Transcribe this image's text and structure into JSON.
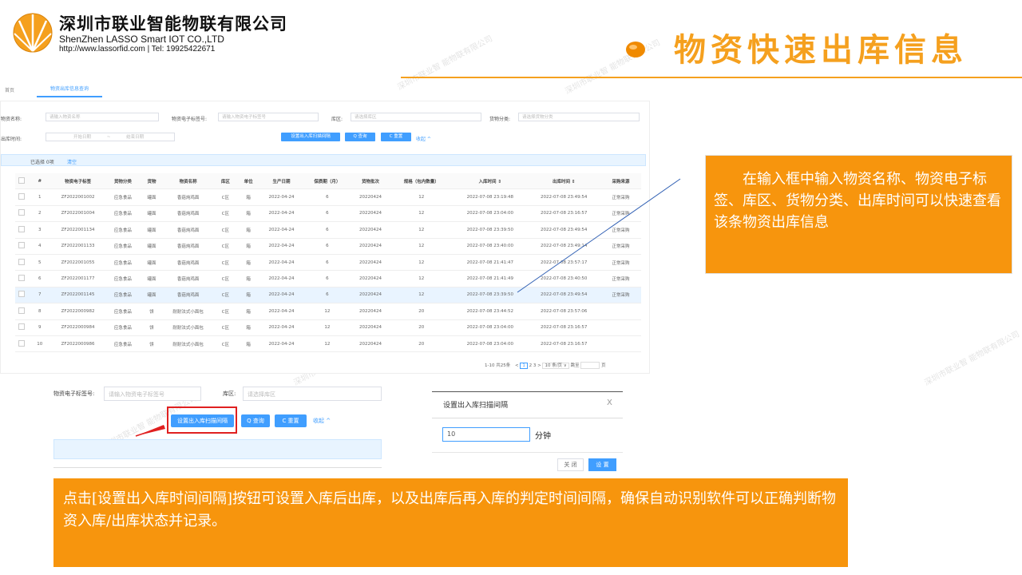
{
  "header": {
    "company_cn": "深圳市联业智能物联有限公司",
    "company_en": "ShenZhen LASSO Smart IOT CO.,LTD",
    "company_contact": "http://www.lassorfid.com | Tel: 19925422671",
    "page_title": "物资快速出库信息"
  },
  "colors": {
    "accent": "#f5a01e",
    "callout": "#f7950d",
    "primary": "#409eff"
  },
  "app": {
    "breadcrumb_home": "首页",
    "active_tab": "物资出库信息查询",
    "filters": {
      "material_name_label": "物资名称:",
      "material_name_placeholder": "请输入物资名称",
      "tag_label": "物资电子标签号:",
      "tag_placeholder": "请输入物资电子标签号",
      "area_label": "库区:",
      "area_placeholder": "请选择库区",
      "category_label": "货物分类:",
      "category_placeholder": "请选择货物分类",
      "out_time_label": "出库时间:",
      "start_placeholder": "开始日期",
      "range_sep": "~",
      "end_placeholder": "结束日期"
    },
    "buttons": {
      "set_interval": "设置出入库扫描间隔",
      "search": "Q 查询",
      "reset": "C 重置",
      "collapse": "收起 ^"
    },
    "selection": {
      "selected": "已选择 0项",
      "clear": "清空"
    },
    "table": {
      "columns": [
        "#",
        "物资电子标签",
        "货物分类",
        "货物",
        "物资名称",
        "库区",
        "单位",
        "生产日期",
        "保质期（月）",
        "货物批次",
        "规格（包内数量）",
        "入库时间 ⇕",
        "出库时间 ⇕",
        "采购来源"
      ],
      "rows": [
        [
          "1",
          "ZF2022001002",
          "应急食品",
          "罐面",
          "香菇炖鸡面",
          "C区",
          "箱",
          "2022-04-24",
          "6",
          "20220424",
          "12",
          "2022-07-08 23:19:48",
          "2022-07-08 23:49:54",
          "正常采购"
        ],
        [
          "2",
          "ZF2022001004",
          "应急食品",
          "罐面",
          "香菇炖鸡面",
          "C区",
          "箱",
          "2022-04-24",
          "6",
          "20220424",
          "12",
          "2022-07-08 23:04:00",
          "2022-07-08 23:16:57",
          "正常采购"
        ],
        [
          "3",
          "ZF2022001134",
          "应急食品",
          "罐面",
          "香菇炖鸡面",
          "C区",
          "箱",
          "2022-04-24",
          "6",
          "20220424",
          "12",
          "2022-07-08 23:39:50",
          "2022-07-08 23:49:54",
          "正常采购"
        ],
        [
          "4",
          "ZF2022001133",
          "应急食品",
          "罐面",
          "香菇炖鸡面",
          "C区",
          "箱",
          "2022-04-24",
          "6",
          "20220424",
          "12",
          "2022-07-08 23:40:00",
          "2022-07-08 23:49:14",
          "正常采购"
        ],
        [
          "5",
          "ZF2022001055",
          "应急食品",
          "罐面",
          "香菇炖鸡面",
          "C区",
          "箱",
          "2022-04-24",
          "6",
          "20220424",
          "12",
          "2022-07-08 21:41:47",
          "2022-07-08 23:57:17",
          "正常采购"
        ],
        [
          "6",
          "ZF2022001177",
          "应急食品",
          "罐面",
          "香菇炖鸡面",
          "C区",
          "箱",
          "2022-04-24",
          "6",
          "20220424",
          "12",
          "2022-07-08 21:41:49",
          "2022-07-08 23:40:50",
          "正常采购"
        ],
        [
          "7",
          "ZF2022001145",
          "应急食品",
          "罐面",
          "香菇炖鸡面",
          "C区",
          "箱",
          "2022-04-24",
          "6",
          "20220424",
          "12",
          "2022-07-08 23:39:50",
          "2022-07-08 23:49:54",
          "正常采购"
        ],
        [
          "8",
          "ZF2022000982",
          "应急食品",
          "饼",
          "耐耐法式小面包",
          "C区",
          "箱",
          "2022-04-24",
          "12",
          "20220424",
          "20",
          "2022-07-08 23:44:52",
          "2022-07-08 23:57:06",
          ""
        ],
        [
          "9",
          "ZF2022000984",
          "应急食品",
          "饼",
          "耐耐法式小面包",
          "C区",
          "箱",
          "2022-04-24",
          "12",
          "20220424",
          "20",
          "2022-07-08 23:04:00",
          "2022-07-08 23:16:57",
          ""
        ],
        [
          "10",
          "ZF2022000986",
          "应急食品",
          "饼",
          "耐耐法式小面包",
          "C区",
          "箱",
          "2022-04-24",
          "12",
          "20220424",
          "20",
          "2022-07-08 23:04:00",
          "2022-07-08 23:16:57",
          ""
        ]
      ],
      "highlight_row": 7
    },
    "pagination": {
      "summary": "1-10 共25条",
      "prev": "<",
      "pages": [
        "1",
        "2",
        "3"
      ],
      "current_page": "1",
      "next": ">",
      "page_size": "10 条/页 ∨",
      "goto": "跳至",
      "goto_suffix": "页"
    }
  },
  "zoom": {
    "tag_label": "物资电子标签号:",
    "tag_placeholder": "请输入物资电子标签号",
    "area_label": "库区:",
    "area_placeholder": "请选择库区",
    "set_interval": "设置出入库扫描间隔",
    "search": "Q 查询",
    "reset": "C 重置",
    "collapse": "收起 ^"
  },
  "dialog": {
    "title": "设置出入库扫描间隔",
    "close": "X",
    "value": "10",
    "unit": "分钟",
    "cancel": "关 闭",
    "confirm": "设 置"
  },
  "callouts": {
    "right": "在输入框中输入物资名称、物资电子标签、库区、货物分类、出库时间可以快速查看该条物资出库信息",
    "bottom": "点击[设置出入库时间间隔]按钮可设置入库后出库，以及出库后再入库的判定时间间隔，确保自动识别软件可以正确判断物资入库/出库状态并记录。"
  }
}
